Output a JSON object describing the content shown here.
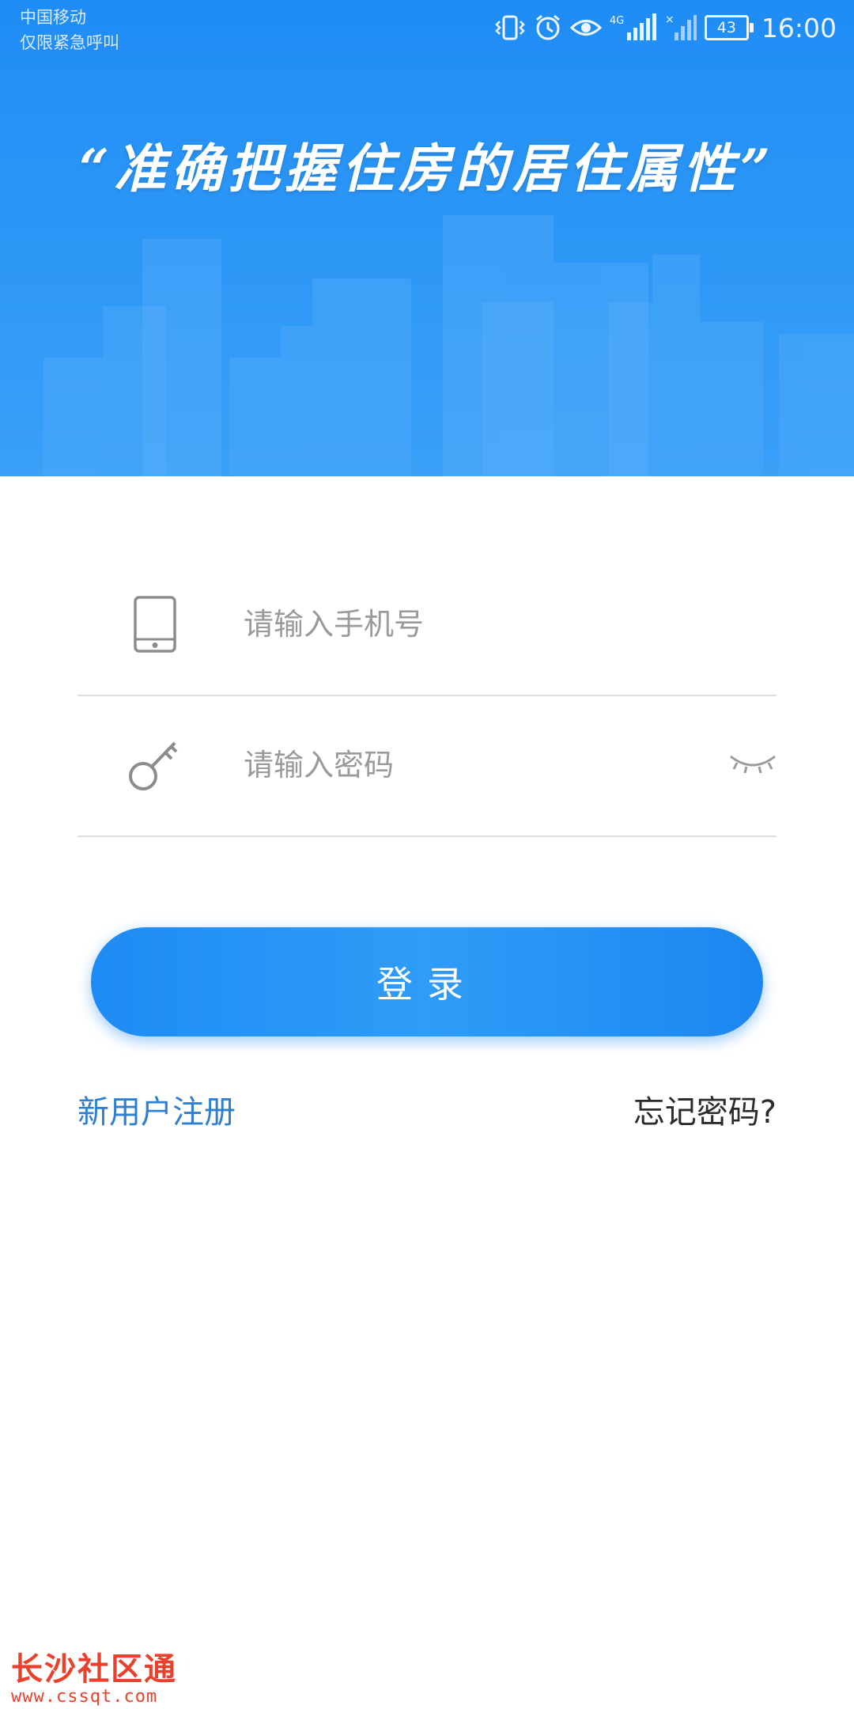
{
  "status_bar": {
    "carrier": "中国移动",
    "carrier_sub": "仅限紧急呼叫",
    "network": "4G",
    "battery": "43",
    "time": "16:00"
  },
  "banner": {
    "slogan": "“准确把握住房的居住属性”",
    "color": "#2a95f6"
  },
  "form": {
    "phone": {
      "placeholder": "请输入手机号",
      "value": ""
    },
    "password": {
      "placeholder": "请输入密码",
      "value": ""
    }
  },
  "actions": {
    "login_label": "登录",
    "register_label": "新用户注册",
    "forgot_label": "忘记密码?"
  },
  "watermark": {
    "title": "长沙社区通",
    "url": "www.cssqt.com"
  },
  "colors": {
    "accent": "#1e8bf4",
    "link": "#2f7fd0"
  },
  "icons": [
    "vibrate-icon",
    "alarm-icon",
    "eye-care-icon",
    "signal-icon",
    "wifi-icon",
    "battery-icon",
    "phone-icon",
    "key-icon",
    "eye-closed-icon"
  ]
}
